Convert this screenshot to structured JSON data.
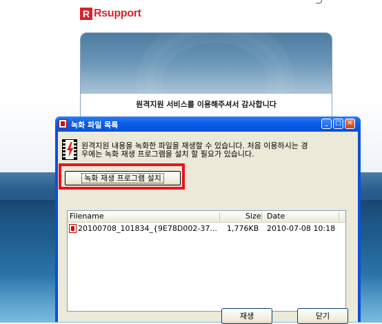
{
  "brand": {
    "logo_mark": "R",
    "logo_text": "Rsupport",
    "accent": "#d8232a"
  },
  "welcome": {
    "message": "원격지원 서비스를 이용해주셔서 감사합니다"
  },
  "dialog": {
    "title": "녹화 파일 목록",
    "title_icon": "film-icon",
    "controls": [
      "minimize-icon",
      "maximize-icon",
      "close-icon"
    ],
    "info_line1": "원격지원 내용을 녹화한 파일을 재생할 수 있습니다. 처음 이용하시는 경",
    "info_line2": "우에는 녹화 재생 프로그램을 설치 할 필요가 있습니다.",
    "install_button": "녹화 재생 프로그램 설치",
    "highlight_color": "#e8131a",
    "list": {
      "columns": [
        "Filename",
        "Size",
        "Date"
      ],
      "rows": [
        {
          "filename": "20100708_101834_{9E78D002-37...",
          "size": "1,776KB",
          "date": "2010-07-08 10:18"
        }
      ]
    },
    "play_button": "재생",
    "close_button": "닫기"
  }
}
